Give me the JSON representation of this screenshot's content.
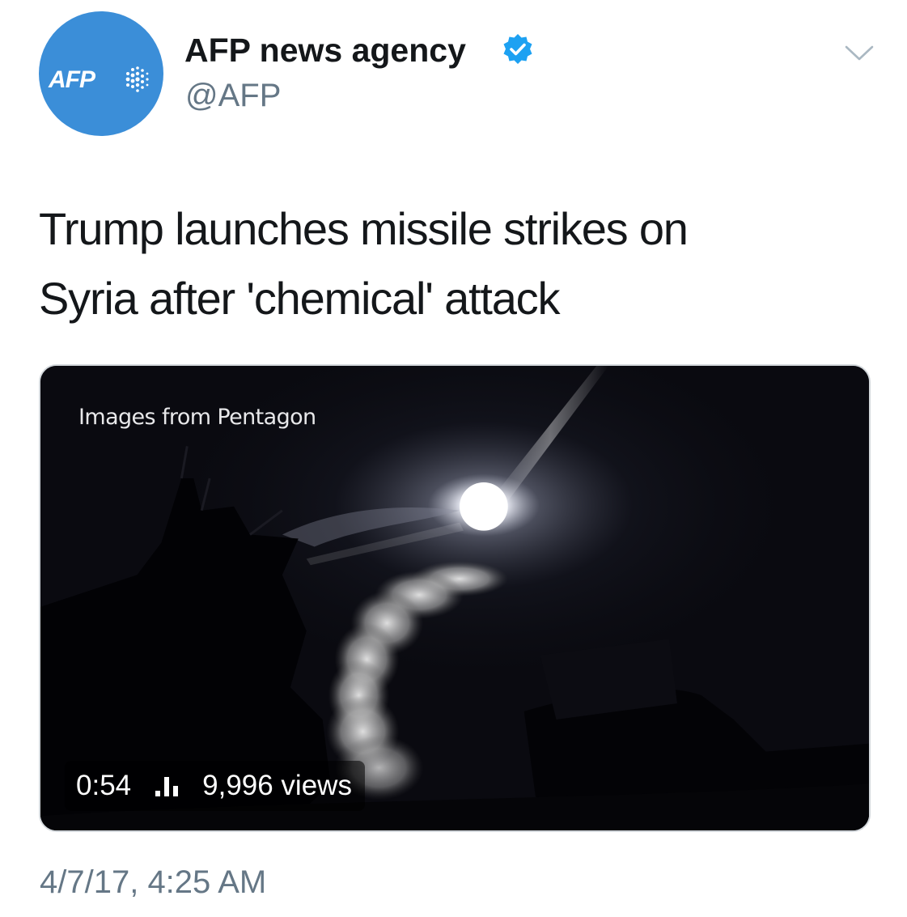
{
  "tweet": {
    "author_name": "AFP news agency",
    "handle": "@AFP",
    "avatar_text": "AFP",
    "verified": true,
    "text_lines": [
      "Trump launches missile strikes on",
      "Syria after 'chemical' attack"
    ],
    "media": {
      "caption": "Images from Pentagon",
      "duration": "0:54",
      "views": "9,996 views"
    },
    "timestamp": "4/7/17, 4:25 AM"
  },
  "icons": {
    "verified": "verified-badge-icon",
    "menu": "chevron-down-icon",
    "views": "view-count-icon"
  },
  "colors": {
    "avatar_bg": "#3b8ed8",
    "verified_blue": "#1da1f2",
    "muted_text": "#657786",
    "primary_text": "#14171a"
  }
}
